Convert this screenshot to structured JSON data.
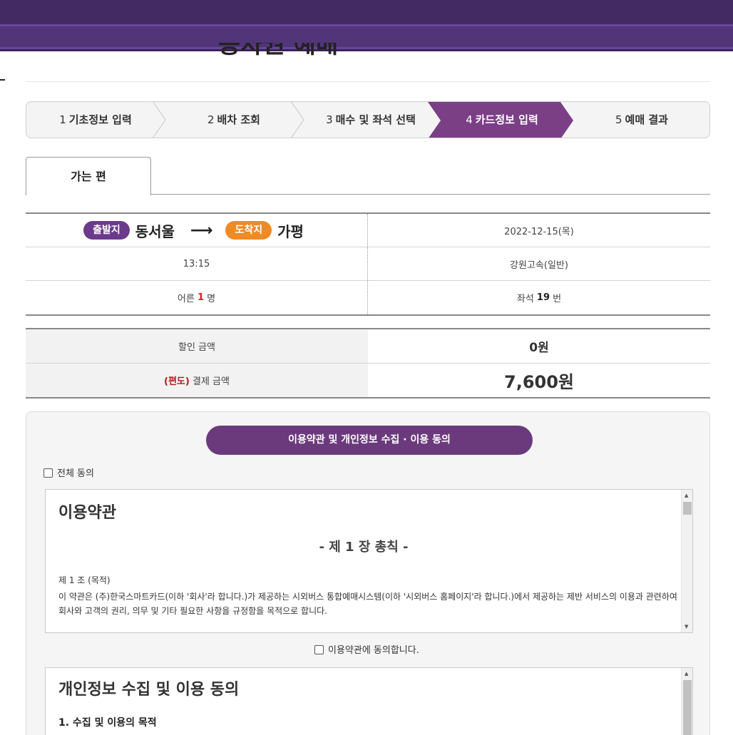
{
  "header": {
    "page_title": "승차권 예매"
  },
  "steps": [
    {
      "num": "1",
      "label": "기초정보 입력"
    },
    {
      "num": "2",
      "label": "배차 조회"
    },
    {
      "num": "3",
      "label": "매수 및 좌석 선택"
    },
    {
      "num": "4",
      "label": "카드정보 입력"
    },
    {
      "num": "5",
      "label": "예매 결과"
    }
  ],
  "colors": {
    "active_step": "#7b3f86",
    "departure_badge": "#6b3a8a",
    "arrival_badge": "#f08a24",
    "agree_pill": "#6b3a7c"
  },
  "tab": {
    "label": "가는 편"
  },
  "trip": {
    "departure_badge": "출발지",
    "departure_city": "동서울",
    "arrow": "⟶",
    "arrival_badge": "도착지",
    "arrival_city": "가평",
    "date": "2022-12-15(목)",
    "time": "13:15",
    "company": "강원고속(일반)",
    "passenger_prefix": "어른",
    "passenger_count": "1",
    "passenger_suffix": "명",
    "seat_prefix": "좌석",
    "seat_number": "19",
    "seat_suffix": "번"
  },
  "payment": {
    "discount_label": "할인 금액",
    "discount_value": "0원",
    "oneway_label": "(편도)",
    "total_label": "결제 금액",
    "total_value": "7,600원"
  },
  "agreement": {
    "section_title": "이용약관 및 개인정보 수집 · 이용 동의",
    "all_agree": "전체 동의",
    "terms_title": "이용약관",
    "chapter": "- 제 1 장 총칙 -",
    "article": "제 1 조 (목적)",
    "article_body": "이 약관은 (주)한국스마트카드(이하 '회사'라 합니다.)가 제공하는 시외버스 통합예매시스템(이하 '시외버스 홈페이지'라 합니다.)에서 제공하는 제반 서비스의 이용과 관련하여 회사와 고객의 권리, 의무 및 기타 필요한 사항을 규정함을 목적으로 합니다.",
    "terms_agree": "이용약관에 동의합니다.",
    "privacy_title": "개인정보 수집 및 이용 동의",
    "privacy_item": "1. 수집 및 이용의 목적"
  }
}
